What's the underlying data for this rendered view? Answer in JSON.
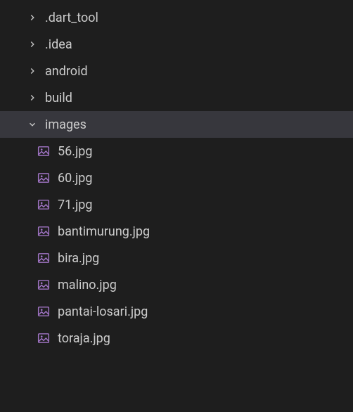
{
  "tree": {
    "folders": [
      {
        "label": ".dart_tool",
        "expanded": false
      },
      {
        "label": ".idea",
        "expanded": false
      },
      {
        "label": "android",
        "expanded": false
      },
      {
        "label": "build",
        "expanded": false
      },
      {
        "label": "images",
        "expanded": true
      }
    ],
    "images_children": [
      {
        "label": "56.jpg"
      },
      {
        "label": "60.jpg"
      },
      {
        "label": "71.jpg"
      },
      {
        "label": "bantimurung.jpg"
      },
      {
        "label": "bira.jpg"
      },
      {
        "label": "malino.jpg"
      },
      {
        "label": "pantai-losari.jpg"
      },
      {
        "label": "toraja.jpg"
      }
    ]
  },
  "colors": {
    "icon_purple": "#a074c4",
    "chevron_grey": "#c5c5c5",
    "text": "#cccccc",
    "bg": "#1e1e1e",
    "active_bg": "#37373d"
  }
}
